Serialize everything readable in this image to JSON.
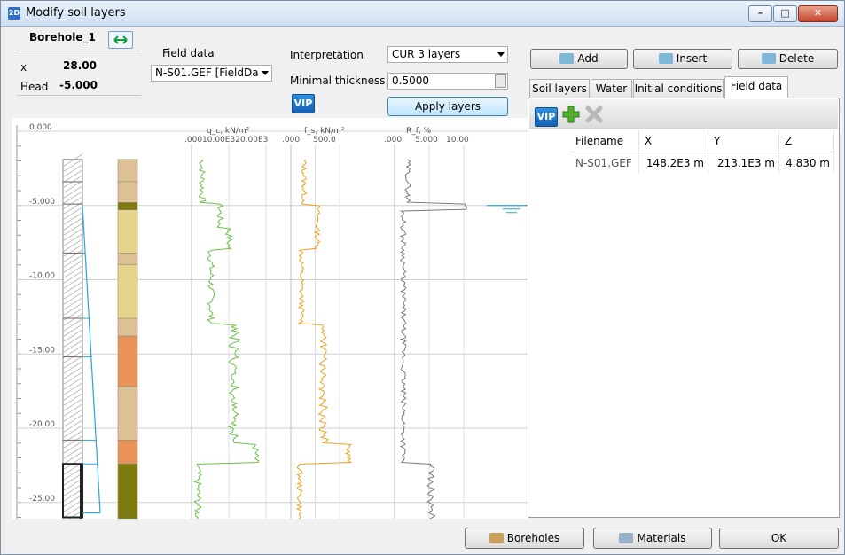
{
  "window": {
    "title": "Modify soil layers",
    "icon_text": "2D",
    "controls": [
      "minimize-icon",
      "maximize-icon",
      "close-icon"
    ]
  },
  "borehole": {
    "name": "Borehole_1",
    "x_label": "x",
    "x_value": "28.00",
    "head_label": "Head",
    "head_value": "-5.000"
  },
  "field_data": {
    "label": "Field data",
    "selected": "N-S01.GEF [FieldDa"
  },
  "interpretation": {
    "label": "Interpretation",
    "selected": "CUR 3 layers",
    "min_thickness_label": "Minimal thickness",
    "min_thickness_value": "0.5000",
    "vip_label": "VIP",
    "apply_label": "Apply layers"
  },
  "actions": {
    "add": "Add",
    "insert": "Insert",
    "delete": "Delete"
  },
  "tabs": [
    "Soil layers",
    "Water",
    "Initial conditions",
    "Field data"
  ],
  "active_tab": "Field data",
  "fielddata_table": {
    "vip_label": "VIP",
    "columns": [
      "Filename",
      "X",
      "Y",
      "Z"
    ],
    "rows": [
      [
        "N-S01.GEF",
        "148.2E3 m",
        "213.1E3 m",
        "4.830 m"
      ]
    ]
  },
  "footer": {
    "boreholes": "Boreholes",
    "materials": "Materials",
    "ok": "OK"
  },
  "plot": {
    "depth_ticks": [
      "0.000",
      "-5.000",
      "-10.00",
      "-15.00",
      "-20.00",
      "-25.00"
    ],
    "qc_title": "q_c, kN/m²",
    "qc_ticks": ".00010.00E320.00E3",
    "fs_title": "f_s, kN/m²",
    "fs_ticks": [
      ".000",
      "500.0"
    ],
    "rf_title": "R_f, %",
    "rf_ticks": [
      ".000",
      "5.000",
      "10.00"
    ],
    "colors": {
      "qc": "#6cc04a",
      "fs": "#f0a020",
      "rf": "#7a7a7a",
      "water": "#29a3e0",
      "layer_tan": "#dcc196",
      "layer_sand": "#e6d48c",
      "layer_orange": "#e8935a",
      "layer_olive": "#7d7a10"
    }
  }
}
